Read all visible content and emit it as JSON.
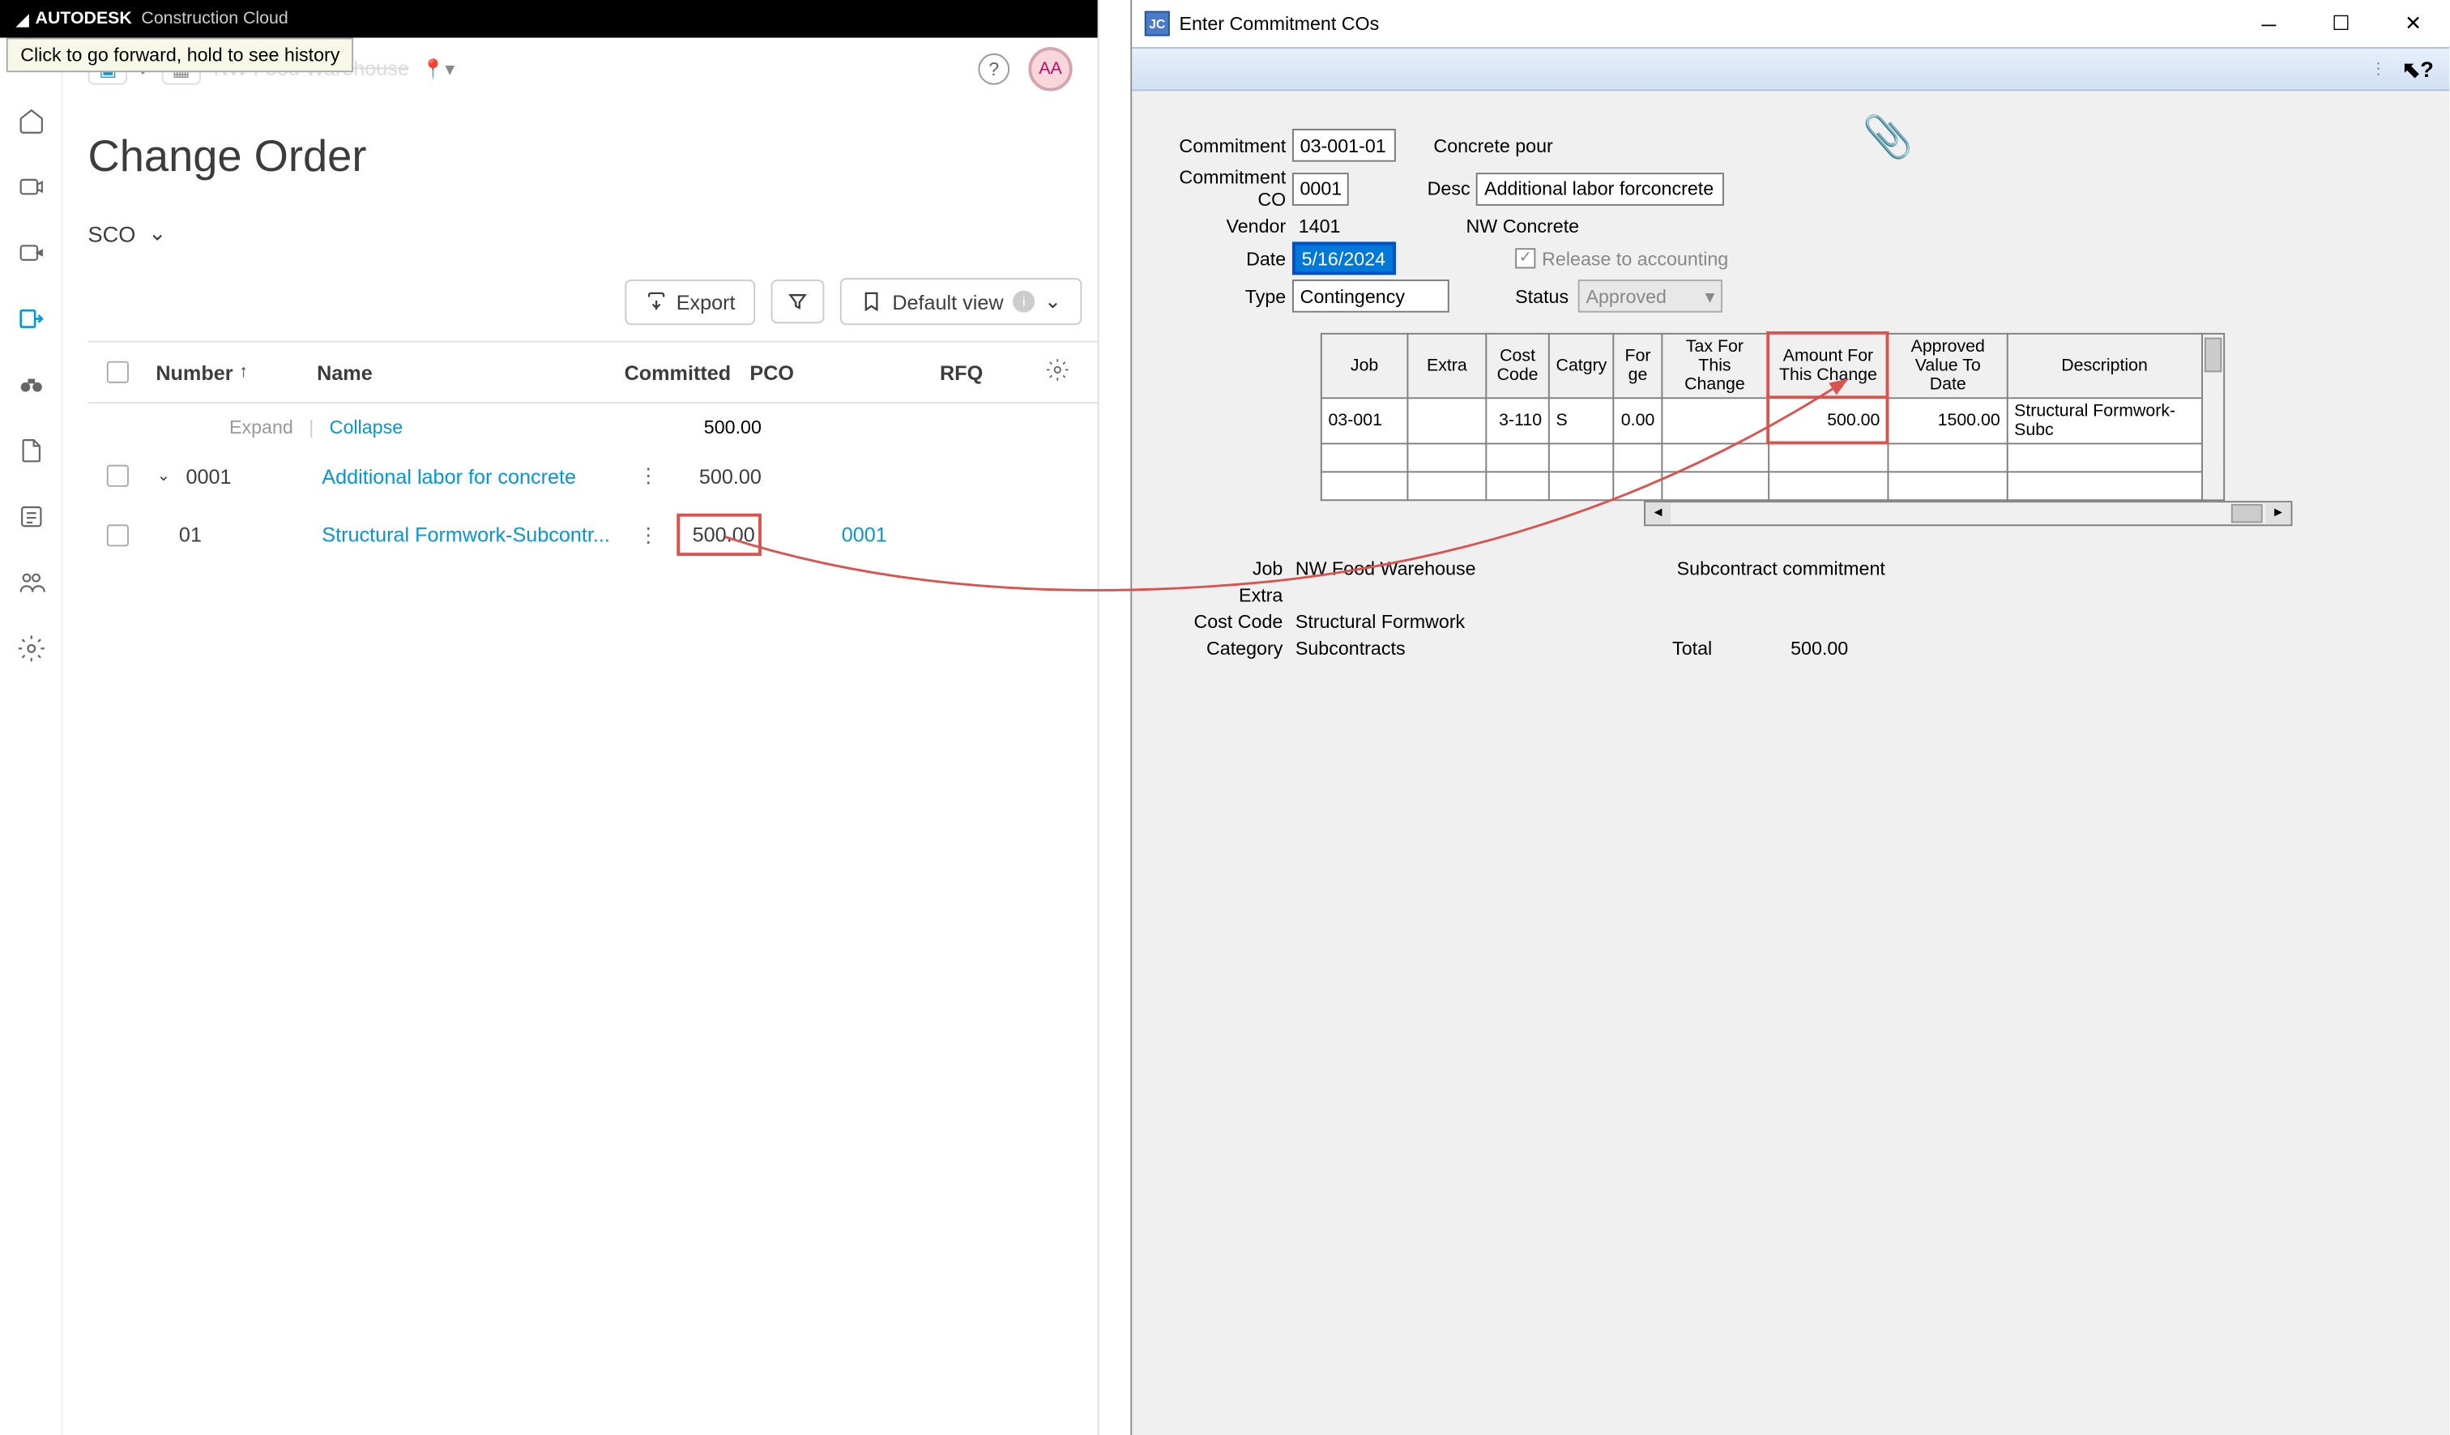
{
  "left": {
    "brand_icon_text": "◢",
    "brand_bold": "AUTODESK",
    "brand_light": "Construction Cloud",
    "tooltip": "Click to go forward, hold to see history",
    "breadcrumb_text": "NW Food Warehouse",
    "avatar": "AA",
    "page_title": "Change Order",
    "sco_label": "SCO",
    "export_label": "Export",
    "view_label": "Default view",
    "headers": {
      "number": "Number",
      "name": "Name",
      "committed": "Committed",
      "pco": "PCO",
      "rfq": "RFQ"
    },
    "expand": "Expand",
    "collapse": "Collapse",
    "rows": [
      {
        "num": "",
        "name": "",
        "committed": "500.00"
      },
      {
        "num": "0001",
        "name": "Additional labor for concrete",
        "committed": "500.00"
      },
      {
        "num": "01",
        "name": "Structural Formwork-Subcontr...",
        "committed": "500.00",
        "pco": "0001"
      }
    ]
  },
  "right": {
    "title": "Enter Commitment COs",
    "fields": {
      "commitment_lbl": "Commitment",
      "commitment_val": "03-001-01",
      "commitment_desc": "Concrete pour",
      "co_lbl": "Commitment CO",
      "co_val": "0001",
      "desc_lbl": "Desc",
      "desc_val": "Additional labor forconcrete",
      "vendor_lbl": "Vendor",
      "vendor_val": "1401",
      "vendor_name": "NW Concrete",
      "date_lbl": "Date",
      "date_val": "5/16/2024",
      "release_lbl": "Release to accounting",
      "type_lbl": "Type",
      "type_val": "Contingency",
      "status_lbl": "Status",
      "status_val": "Approved"
    },
    "grid": {
      "headers": [
        "Job",
        "Extra",
        "Cost\nCode",
        "Catgry",
        "For\nge",
        "Tax For\nThis Change",
        "Amount For\nThis Change",
        "Approved\nValue To Date",
        "Description"
      ],
      "row": {
        "job": "03-001",
        "extra": "",
        "cost_code": "3-110",
        "catgry": "S",
        "forge": "0.00",
        "tax": "",
        "amount": "500.00",
        "approved": "1500.00",
        "desc": "Structural Formwork-Subc"
      }
    },
    "summary": {
      "job_lbl": "Job",
      "job_val": "NW Food Warehouse",
      "subcontract": "Subcontract commitment",
      "extra_lbl": "Extra",
      "costcode_lbl": "Cost Code",
      "costcode_val": "Structural Formwork",
      "category_lbl": "Category",
      "category_val": "Subcontracts",
      "total_lbl": "Total",
      "total_val": "500.00"
    }
  }
}
